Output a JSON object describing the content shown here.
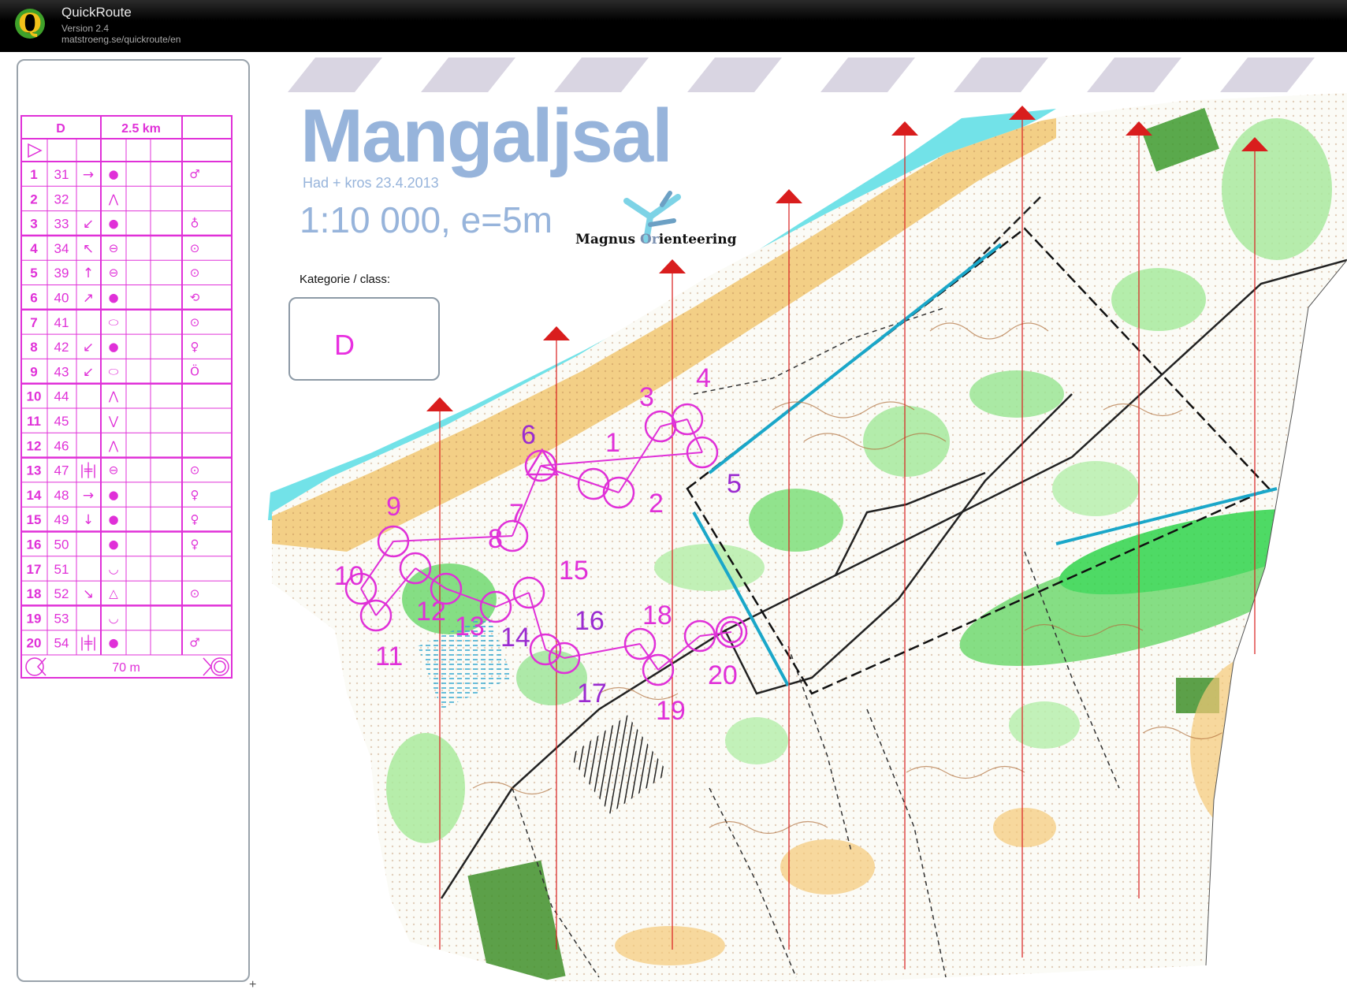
{
  "app": {
    "title": "QuickRoute",
    "version": "Version 2.4",
    "url": "matstroeng.se/quickroute/en",
    "logo_letter": "Q"
  },
  "colors": {
    "course_magenta": "#e030d8",
    "water_cyan": "#72e2e8",
    "map_title_blue": "#97b4db",
    "forest_green": "#6fd96f",
    "open_yellow": "#f5c977",
    "north_line_red": "#d91d1d"
  },
  "map": {
    "title": "Mangaljsal",
    "subtitle": "Had + kros 23.4.2013",
    "scale": "1:10 000, e=5m",
    "club": {
      "name_a": "Magnus ",
      "name_b": "Or",
      "name_c": "ienteering"
    },
    "class_label": "Kategorie / class:",
    "class_value": "D",
    "control_labels": [
      "1",
      "2",
      "3",
      "4",
      "5",
      "6",
      "7",
      "8",
      "9",
      "10",
      "11",
      "12",
      "13",
      "14",
      "15",
      "16",
      "17",
      "18",
      "19",
      "20"
    ]
  },
  "description_sheet": {
    "class": "D",
    "length": "2.5 km",
    "finish_distance": "70 m",
    "rows": [
      {
        "num": "1",
        "code": "31",
        "dir": "→",
        "feat": "●",
        "extra": "♂"
      },
      {
        "num": "2",
        "code": "32",
        "dir": "",
        "feat": "⋀",
        "extra": ""
      },
      {
        "num": "3",
        "code": "33",
        "dir": "↙",
        "feat": "●",
        "extra": "♁"
      },
      {
        "num": "4",
        "code": "34",
        "dir": "↖",
        "feat": "⊖",
        "extra": "⊙"
      },
      {
        "num": "5",
        "code": "39",
        "dir": "↑",
        "feat": "⊖",
        "extra": "⊙"
      },
      {
        "num": "6",
        "code": "40",
        "dir": "↗",
        "feat": "●",
        "extra": "⟲"
      },
      {
        "num": "7",
        "code": "41",
        "dir": "",
        "feat": "⬭",
        "extra": "⊙"
      },
      {
        "num": "8",
        "code": "42",
        "dir": "↙",
        "feat": "●",
        "extra": "♀"
      },
      {
        "num": "9",
        "code": "43",
        "dir": "↙",
        "feat": "⬭",
        "extra": "Ö"
      },
      {
        "num": "10",
        "code": "44",
        "dir": "",
        "feat": "⋀",
        "extra": ""
      },
      {
        "num": "11",
        "code": "45",
        "dir": "",
        "feat": "⋁",
        "extra": ""
      },
      {
        "num": "12",
        "code": "46",
        "dir": "",
        "feat": "⋀",
        "extra": ""
      },
      {
        "num": "13",
        "code": "47",
        "dir": "|╪|",
        "feat": "⊖",
        "extra": "⊙"
      },
      {
        "num": "14",
        "code": "48",
        "dir": "→",
        "feat": "●",
        "extra": "♀"
      },
      {
        "num": "15",
        "code": "49",
        "dir": "↓",
        "feat": "●",
        "extra": "♀"
      },
      {
        "num": "16",
        "code": "50",
        "dir": "",
        "feat": "●",
        "extra": "♀"
      },
      {
        "num": "17",
        "code": "51",
        "dir": "",
        "feat": "◡",
        "extra": ""
      },
      {
        "num": "18",
        "code": "52",
        "dir": "↘",
        "feat": "△",
        "extra": "⊙"
      },
      {
        "num": "19",
        "code": "53",
        "dir": "",
        "feat": "◡",
        "extra": ""
      },
      {
        "num": "20",
        "code": "54",
        "dir": "|╪|",
        "feat": "●",
        "extra": "♂"
      }
    ]
  }
}
